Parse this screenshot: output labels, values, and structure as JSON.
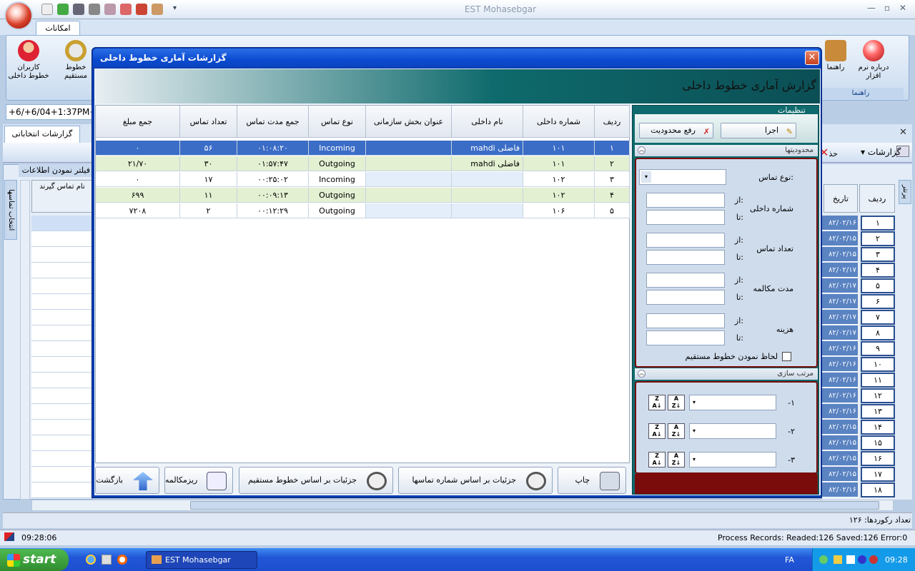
{
  "app": {
    "title": "EST Mohasebgar"
  },
  "ribbon": {
    "tab": "امکانات",
    "about_label": "درباره نرم افزار",
    "help_label": "راهنما",
    "help_group_label": "راهنما",
    "internal_users_label": "کاربران خطوط داخلی",
    "direct_lines_label": "خطوط مستقیم"
  },
  "date_field": "+6/+6/04+1:37PM+1",
  "main": {
    "tab": "گزارشات انتخاباتی",
    "toolbar_reports": "گزارشات",
    "toolbar_delete_partial": "حذ",
    "filter_partial": "فیلتر نمودن اطلاعات",
    "left_vtab": "انتخاب تماسها",
    "left_header": "نام تماس گیرند",
    "right_vtab": "پرنتر",
    "right_header_date": "تاریخ",
    "right_header_row": "ردیف",
    "right_rows": [
      {
        "date": "۸۲/۰۲/۱۶",
        "num": "۱"
      },
      {
        "date": "۸۲/۰۲/۱۵",
        "num": "۲"
      },
      {
        "date": "۸۲/۰۲/۱۵",
        "num": "۳"
      },
      {
        "date": "۸۲/۰۲/۱۷",
        "num": "۴"
      },
      {
        "date": "۸۲/۰۲/۱۷",
        "num": "۵"
      },
      {
        "date": "۸۲/۰۲/۱۷",
        "num": "۶"
      },
      {
        "date": "۸۲/۰۲/۱۷",
        "num": "۷"
      },
      {
        "date": "۸۲/۰۲/۱۷",
        "num": "۸"
      },
      {
        "date": "۸۲/۰۲/۱۶",
        "num": "۹"
      },
      {
        "date": "۸۲/۰۲/۱۶",
        "num": "۱۰"
      },
      {
        "date": "۸۲/۰۲/۱۶",
        "num": "۱۱"
      },
      {
        "date": "۸۲/۰۲/۱۶",
        "num": "۱۲"
      },
      {
        "date": "۸۲/۰۲/۱۶",
        "num": "۱۳"
      },
      {
        "date": "۸۲/۰۲/۱۵",
        "num": "۱۴"
      },
      {
        "date": "۸۲/۰۲/۱۵",
        "num": "۱۵"
      },
      {
        "date": "۸۲/۰۲/۱۵",
        "num": "۱۶"
      },
      {
        "date": "۸۲/۰۲/۱۵",
        "num": "۱۷"
      },
      {
        "date": "۸۲/۰۲/۱۶",
        "num": "۱۸"
      }
    ],
    "record_count": "تعداد رکوردها: ۱۲۶"
  },
  "status": {
    "time": "09:28:06",
    "process": "Process Records:  Readed:126  Saved:126  Error:0"
  },
  "taskbar": {
    "start": "start",
    "app": "EST Mohasebgar",
    "lang": "FA",
    "clock": "09:28"
  },
  "dialog": {
    "title": "گزارشات آماری خطوط داخلی",
    "heading": "گزارش آماری خطوط داخلی",
    "columns": [
      "ردیف",
      "شماره داخلی",
      "نام داخلی",
      "عنوان بخش سازمانی",
      "نوع تماس",
      "جمع مدت تماس",
      "تعداد تماس",
      "جمع مبلغ"
    ],
    "rows": [
      {
        "row": "۱",
        "ext": "۱۰۱",
        "name": "mahdi فاضلی",
        "dept": "",
        "type": "Incoming",
        "duration": "۰۱:۰۸:۲۰",
        "count": "۵۶",
        "amount": "۰"
      },
      {
        "row": "۲",
        "ext": "۱۰۱",
        "name": "mahdi فاضلی",
        "dept": "",
        "type": "Outgoing",
        "duration": "۰۱:۵۷:۴۷",
        "count": "۳۰",
        "amount": "۲۱/۷۰"
      },
      {
        "row": "۳",
        "ext": "۱۰۲",
        "name": "",
        "dept": "",
        "type": "Incoming",
        "duration": "۰۰:۲۵:۰۲",
        "count": "۱۷",
        "amount": "۰"
      },
      {
        "row": "۴",
        "ext": "۱۰۲",
        "name": "",
        "dept": "",
        "type": "Outgoing",
        "duration": "۰۰:۰۹:۱۳",
        "count": "۱۱",
        "amount": "۶۹۹"
      },
      {
        "row": "۵",
        "ext": "۱۰۶",
        "name": "",
        "dept": "",
        "type": "Outgoing",
        "duration": "۰۰:۱۲:۲۹",
        "count": "۲",
        "amount": "۷۲۰۸"
      }
    ],
    "buttons": {
      "print": "چاپ",
      "details_by_count": "جزئیات بر اساس شماره تماسها",
      "details_by_direct": "جزئیات بر اساس خطوط مستقیم",
      "call_detail": "ریزمکالمه",
      "back": "بازگشت"
    },
    "settings": {
      "title": "تنظیمات",
      "run": "اجرا",
      "clear_filter": "رفع محدودیت",
      "limits_section": "محدودیتها",
      "call_type_label": "نوع تماس:",
      "ext_number_label": "شماره داخلی",
      "call_count_label": "تعداد تماس",
      "talk_time_label": "مدت مکالمه",
      "cost_label": "هزینه",
      "from_label": "از:",
      "to_label": "تا:",
      "include_direct_label": "لحاظ نمودن خطوط مستقیم",
      "sort_section": "مرتب سازی",
      "sort1": "-۱",
      "sort2": "-۲",
      "sort3": "-۳"
    }
  }
}
